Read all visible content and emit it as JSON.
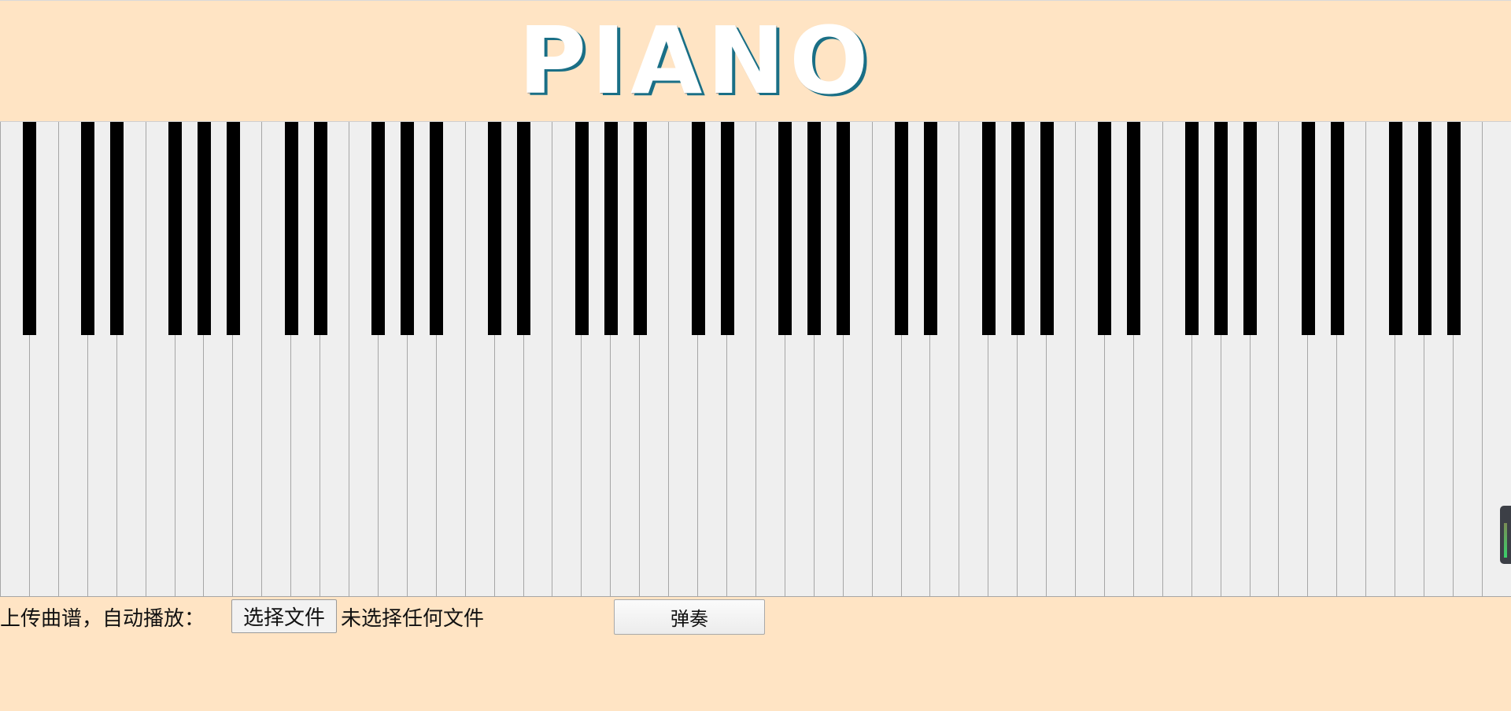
{
  "header": {
    "title": "PIANO"
  },
  "piano": {
    "white_key_count": 52,
    "black_key_count": 36,
    "colors": {
      "background": "#FFE4C4",
      "white_key": "#EFEFEF",
      "black_key": "#000000",
      "title_shadow": "#1A6F86"
    }
  },
  "controls": {
    "upload_label": "上传曲谱，自动播放：",
    "file_button_label": "选择文件",
    "file_status": "未选择任何文件",
    "play_button_label": "弹奏"
  },
  "icons": {
    "volume_widget": "volume-meter-icon"
  }
}
